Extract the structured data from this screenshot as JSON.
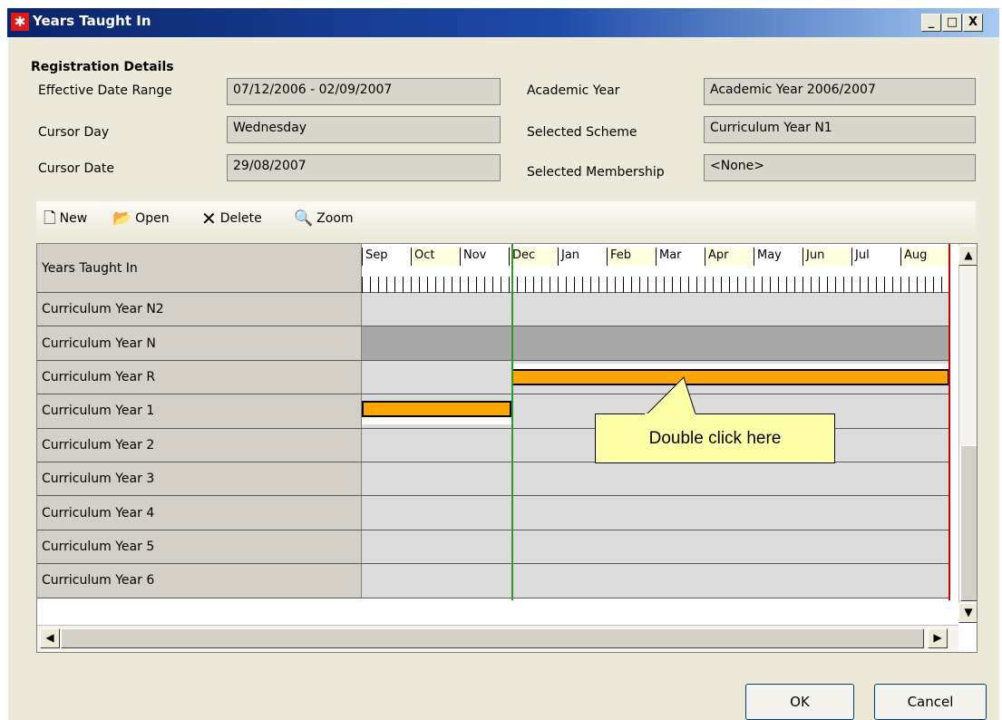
{
  "window": {
    "title": "Years Taught In",
    "controls": {
      "minimize": "_",
      "maximize": "□",
      "close": "X"
    }
  },
  "registration": {
    "heading": "Registration Details",
    "effective_date_range": {
      "label": "Effective Date Range",
      "value": "07/12/2006 - 02/09/2007"
    },
    "cursor_day": {
      "label": "Cursor Day",
      "value": "Wednesday"
    },
    "cursor_date": {
      "label": "Cursor Date",
      "value": "29/08/2007"
    },
    "academic_year": {
      "label": "Academic Year",
      "value": "Academic Year 2006/2007"
    },
    "selected_scheme": {
      "label": "Selected Scheme",
      "value": "Curriculum Year N1"
    },
    "selected_membership": {
      "label": "Selected Membership",
      "value": "<None>"
    }
  },
  "toolbar": {
    "new_label": "New",
    "open_label": "Open",
    "delete_label": "Delete",
    "zoom_label": "Zoom"
  },
  "grid": {
    "header_label": "Years Taught In",
    "months": [
      "Sep",
      "Oct",
      "Nov",
      "Dec",
      "Jan",
      "Feb",
      "Mar",
      "Apr",
      "May",
      "Jun",
      "Jul",
      "Aug"
    ],
    "rows": [
      "Curriculum Year N2",
      "Curriculum Year  N",
      "Curriculum Year  R",
      "Curriculum Year  1",
      "Curriculum Year  2",
      "Curriculum Year  3",
      "Curriculum Year  4",
      "Curriculum Year  5",
      "Curriculum Year  6"
    ]
  },
  "callout": {
    "text": "Double click here"
  },
  "buttons": {
    "ok_label": "OK",
    "cancel_label": "Cancel"
  },
  "colors": {
    "bar": "#ffa500",
    "cursor_line": "#2e9a2e",
    "end_line": "#cc0000",
    "callout": "#ffffa8"
  }
}
